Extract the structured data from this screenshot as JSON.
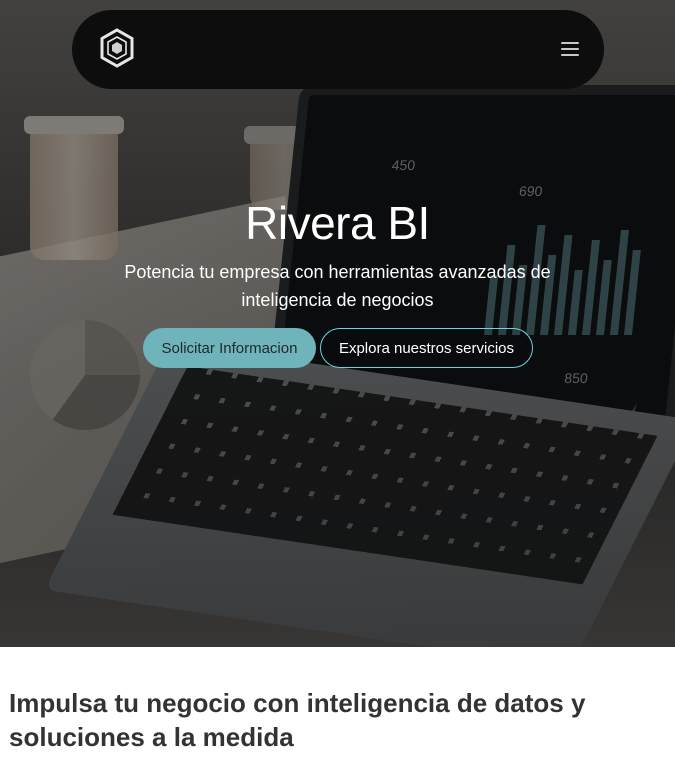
{
  "navbar": {
    "logo_name": "hexagon-cube-logo",
    "menu_icon": "hamburger-menu-icon"
  },
  "hero": {
    "title": "Rivera BI",
    "subtitle": "Potencia tu empresa con herramientas avanzadas de inteligencia de negocios",
    "primary_button": "Solicitar Informacion",
    "secondary_button": "Explora nuestros servicios",
    "screen_numbers": [
      "450",
      "690",
      "850"
    ]
  },
  "section": {
    "title": "Impulsa tu negocio con inteligencia de datos y soluciones a la medida"
  },
  "colors": {
    "accent": "#6fb3bb",
    "accent_border": "#6fd3dc",
    "navbar_bg": "#0d0d0d",
    "text_dark": "#333333"
  }
}
